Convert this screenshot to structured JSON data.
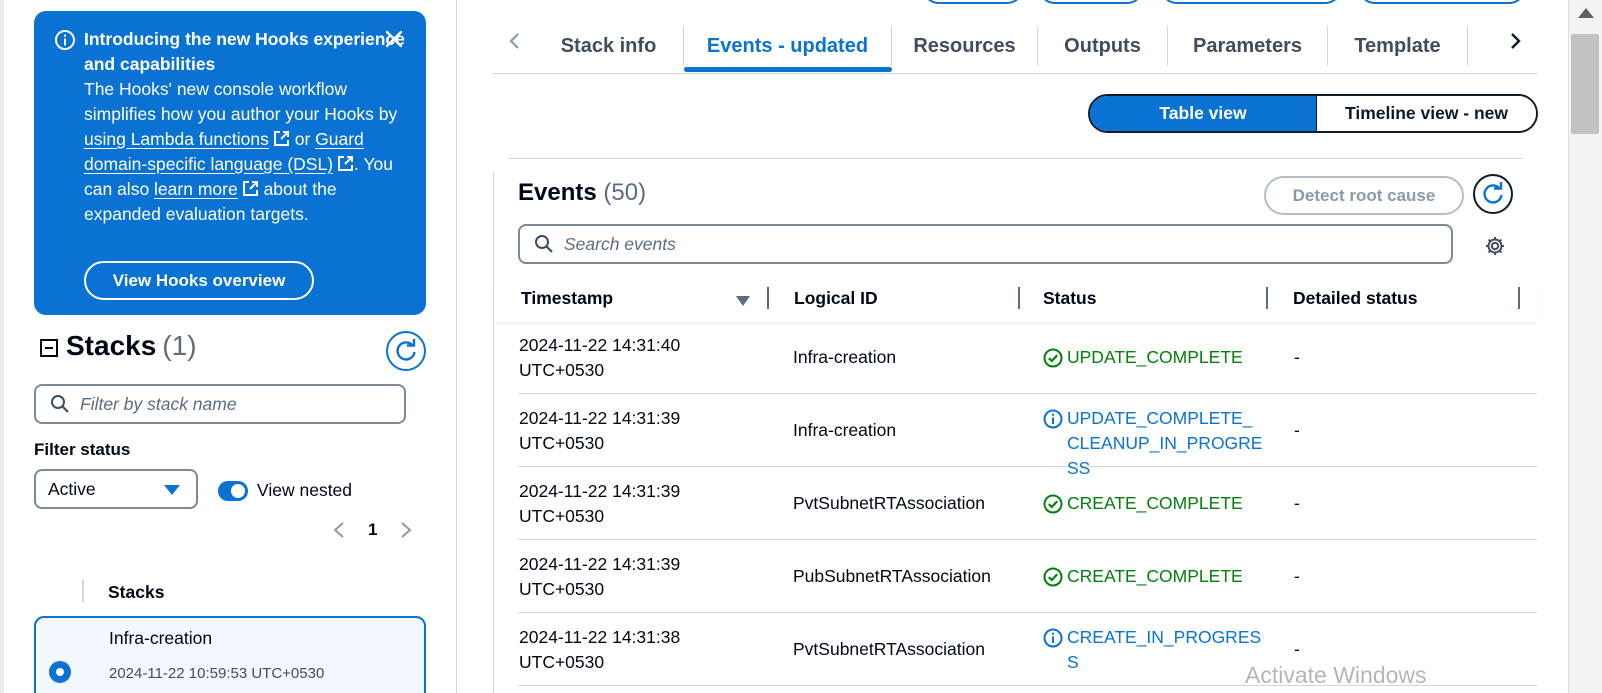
{
  "flash": {
    "title": "Introducing the new Hooks experience and capabilities",
    "body_start": "The Hooks' new console workflow simplifies how you author your Hooks by ",
    "link1": "using Lambda functions",
    "or": " or ",
    "link2": "Guard domain-specific language (DSL)",
    "mid": ". You can also ",
    "link3": "learn more",
    "end": " about the expanded evaluation targets.",
    "button": "View Hooks overview"
  },
  "stacks": {
    "title": "Stacks",
    "count": "(1)",
    "filter_placeholder": "Filter by stack name",
    "filter_status_label": "Filter status",
    "status_value": "Active",
    "view_nested_label": "View nested",
    "page": "1",
    "column_header": "Stacks",
    "items": [
      {
        "name": "Infra-creation",
        "time": "2024-11-22 10:59:53 UTC+0530"
      }
    ]
  },
  "tabs": [
    "Stack info",
    "Events - updated",
    "Resources",
    "Outputs",
    "Parameters",
    "Template"
  ],
  "views": {
    "table": "Table view",
    "timeline": "Timeline view - new"
  },
  "events": {
    "title": "Events",
    "count": "(50)",
    "detect_button": "Detect root cause",
    "search_placeholder": "Search events",
    "columns": [
      "Timestamp",
      "Logical ID",
      "Status",
      "Detailed status"
    ],
    "rows": [
      {
        "time": "2024-11-22 14:31:40 UTC+0530",
        "logical_id": "Infra-creation",
        "status": "UPDATE_COMPLETE",
        "kind": "complete",
        "detail": "-"
      },
      {
        "time": "2024-11-22 14:31:39 UTC+0530",
        "logical_id": "Infra-creation",
        "status": "UPDATE_COMPLETE_CLEANUP_IN_PROGRESS",
        "kind": "progress",
        "detail": "-"
      },
      {
        "time": "2024-11-22 14:31:39 UTC+0530",
        "logical_id": "PvtSubnetRTAssociation",
        "status": "CREATE_COMPLETE",
        "kind": "complete",
        "detail": "-"
      },
      {
        "time": "2024-11-22 14:31:39 UTC+0530",
        "logical_id": "PubSubnetRTAssociation",
        "status": "CREATE_COMPLETE",
        "kind": "complete",
        "detail": "-"
      },
      {
        "time": "2024-11-22 14:31:38 UTC+0530",
        "logical_id": "PvtSubnetRTAssociation",
        "status": "CREATE_IN_PROGRESS",
        "kind": "progress",
        "detail": "-"
      }
    ]
  },
  "watermark": "Activate Windows",
  "colors": {
    "accent": "#0972d3",
    "success": "#037f0c",
    "text": "#000716"
  }
}
